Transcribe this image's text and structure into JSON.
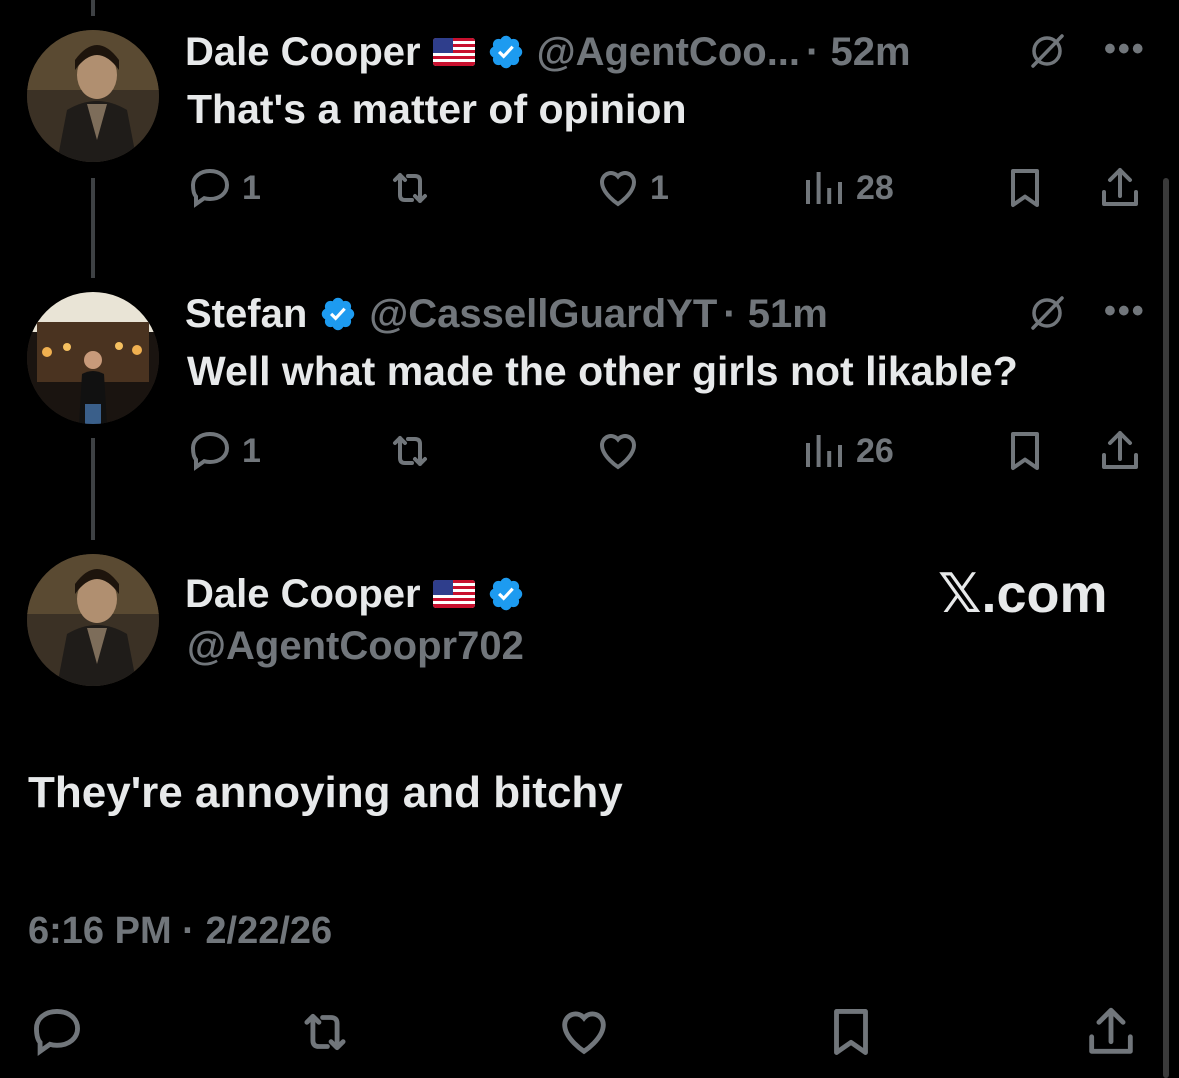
{
  "tweets": [
    {
      "name": "Dale Cooper",
      "flag": "🇺🇸",
      "handle": "@AgentCoo...",
      "time": "· 52m",
      "text": "That's a matter of opinion",
      "replies": "1",
      "retweets": "",
      "likes": "1",
      "views": "28"
    },
    {
      "name": "Stefan",
      "handle": "@CassellGuardYT",
      "time": "· 51m",
      "text": "Well what made the other girls not likable?",
      "replies": "1",
      "retweets": "",
      "likes": "",
      "views": "26"
    }
  ],
  "main": {
    "name": "Dale Cooper",
    "flag": "🇺🇸",
    "handle": "@AgentCoopr702",
    "watermark": "𝕏.com",
    "text": "They're annoying and bitchy",
    "timestamp": "6:16 PM · 2/22/26"
  },
  "icons": {
    "reply": "reply-icon",
    "retweet": "retweet-icon",
    "like": "heart-icon",
    "views": "views-icon",
    "bookmark": "bookmark-icon",
    "share": "share-icon",
    "verified": "verified-badge-icon",
    "grok": "grok-icon",
    "more": "more-icon"
  },
  "colors": {
    "background": "#000000",
    "text": "#e7e9ea",
    "muted": "#71767b",
    "verified": "#1d9bf0"
  }
}
